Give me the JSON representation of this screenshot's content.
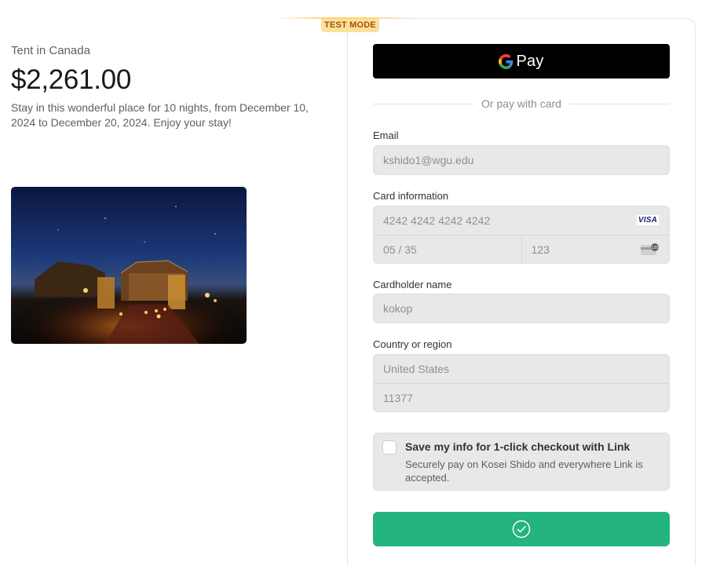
{
  "summary": {
    "product_name": "Tent in Canada",
    "amount": "$2,261.00",
    "description": "Stay in this wonderful place for 10 nights, from December 10, 2024 to December 20, 2024. Enjoy your stay!"
  },
  "badge": {
    "test_mode": "TEST MODE"
  },
  "google_pay": {
    "label": "Pay",
    "icon": "google-g-icon"
  },
  "divider_text": "Or pay with card",
  "email": {
    "label": "Email",
    "value": "kshido1@wgu.edu"
  },
  "card": {
    "label": "Card information",
    "number": "4242 4242 4242 4242",
    "brand": "VISA",
    "expiry": "05 / 35",
    "cvc": "123",
    "cvc_icon": "card-back-icon"
  },
  "cardholder": {
    "label": "Cardholder name",
    "value": "kokop"
  },
  "country": {
    "label": "Country or region",
    "value": "United States",
    "zip": "11377"
  },
  "link": {
    "checked": false,
    "title": "Save my info for 1-click checkout with Link",
    "description": "Securely pay on Kosei Shido and everywhere Link is accepted."
  },
  "pay_button": {
    "state": "success",
    "icon": "checkmark-circle-icon",
    "color": "#24b47e"
  },
  "colors": {
    "panel_border": "#e6e6e6",
    "input_bg": "#e8e8e8",
    "badge_bg": "#fde19a",
    "badge_text": "#a5500c"
  }
}
